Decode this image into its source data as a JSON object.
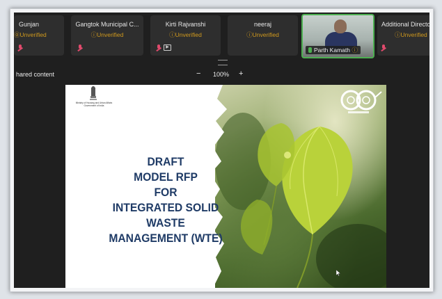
{
  "participants": [
    {
      "name": "Gunjan",
      "status": "Unverified"
    },
    {
      "name": "Gangtok Municipal C...",
      "status": "Unverified"
    },
    {
      "name": "Kirti Rajvanshi",
      "status": "Unverified"
    },
    {
      "name": "neeraj",
      "status": "Unverified"
    },
    {
      "name": "Parth Kamath"
    },
    {
      "name": "Additional Directo",
      "status": "Unverified"
    }
  ],
  "shared": {
    "title": "hared content",
    "zoom_out": "−",
    "zoom_level": "100%",
    "zoom_in": "+"
  },
  "slide": {
    "ministry_line1": "Ministry of Housing and Urban Affairs",
    "ministry_line2": "Government of India",
    "title_lines": [
      "DRAFT",
      "MODEL RFP",
      "FOR",
      "INTEGRATED SOLID",
      "WASTE",
      "MANAGEMENT (WTE)"
    ],
    "title_color": "#1f3b66"
  },
  "colors": {
    "unverified": "#d19a1d",
    "active_speaker": "#4caf50",
    "muted_mic": "#e04a6c"
  }
}
